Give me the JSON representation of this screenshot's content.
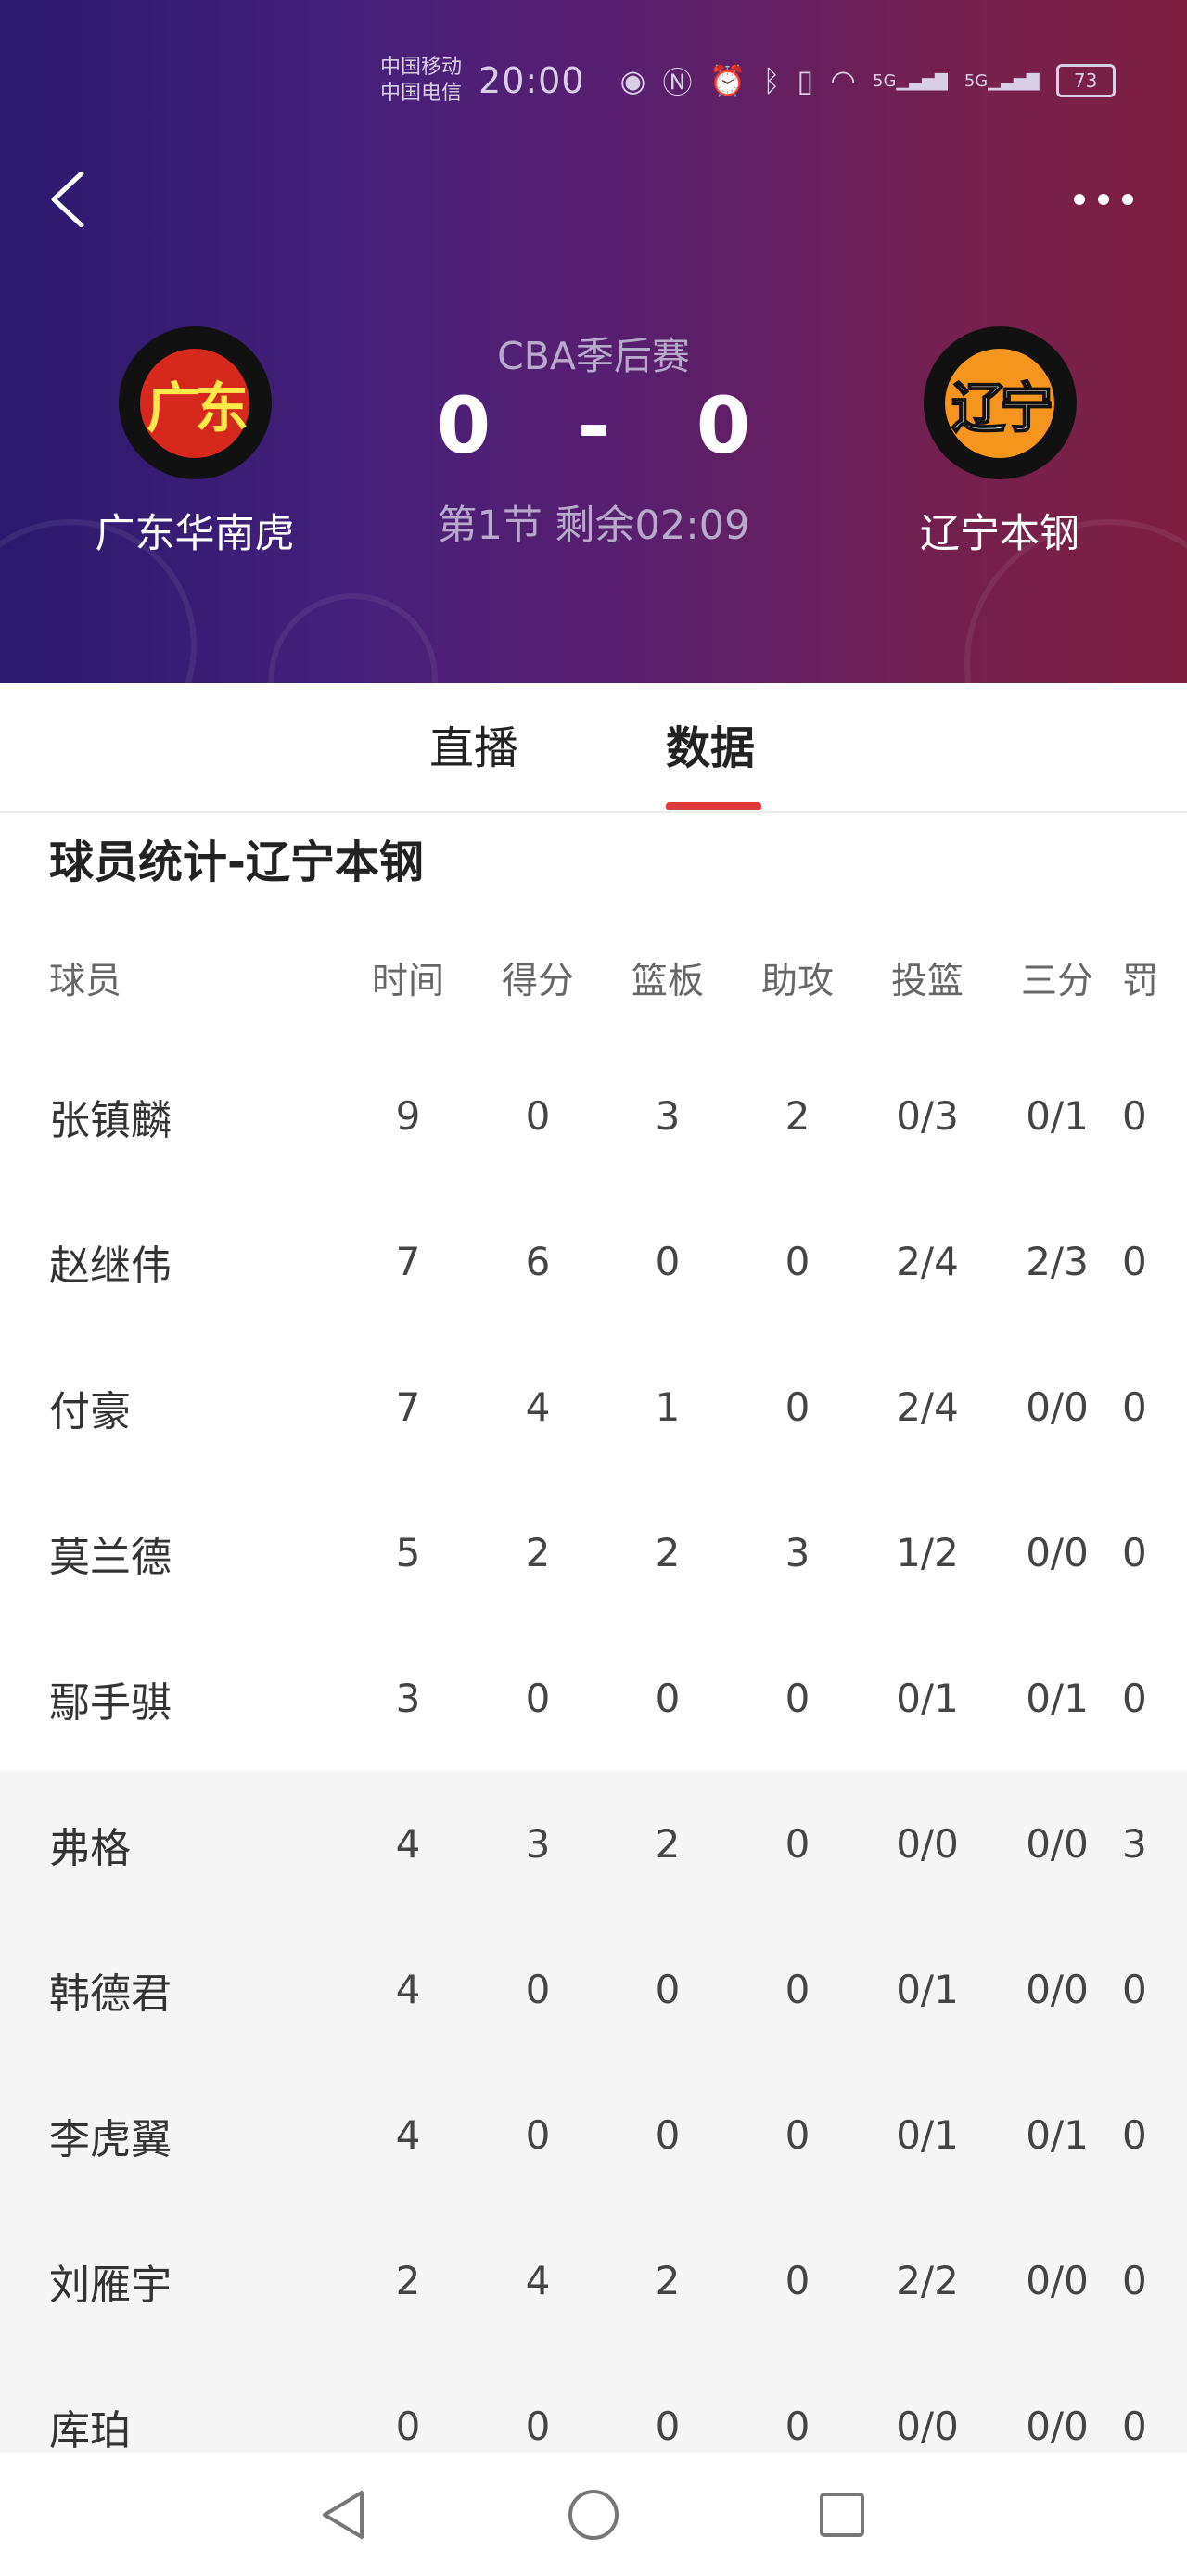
{
  "status": {
    "carrier1": "中国移动",
    "carrier2": "中国电信",
    "time": "20:00",
    "signal1": "5G",
    "signal2": "5G",
    "battery": "73"
  },
  "header": {
    "league": "CBA季后赛",
    "home_team": "广东华南虎",
    "home_logo_text": "广东",
    "away_team": "辽宁本钢",
    "away_logo_text": "辽宁",
    "home_score": "0",
    "separator": "-",
    "away_score": "0",
    "period": "第1节 剩余02:09"
  },
  "tabs": [
    {
      "label": "直播",
      "active": false
    },
    {
      "label": "数据",
      "active": true
    }
  ],
  "stats": {
    "title": "球员统计-辽宁本钢",
    "columns": [
      "球员",
      "时间",
      "得分",
      "篮板",
      "助攻",
      "投篮",
      "三分",
      "罚"
    ],
    "rows": [
      {
        "name": "张镇麟",
        "cells": [
          "9",
          "0",
          "3",
          "2",
          "0/3",
          "0/1",
          "0"
        ]
      },
      {
        "name": "赵继伟",
        "cells": [
          "7",
          "6",
          "0",
          "0",
          "2/4",
          "2/3",
          "0"
        ]
      },
      {
        "name": "付豪",
        "cells": [
          "7",
          "4",
          "1",
          "0",
          "2/4",
          "0/0",
          "0"
        ]
      },
      {
        "name": "莫兰德",
        "cells": [
          "5",
          "2",
          "2",
          "3",
          "1/2",
          "0/0",
          "0"
        ]
      },
      {
        "name": "鄢手骐",
        "cells": [
          "3",
          "0",
          "0",
          "0",
          "0/1",
          "0/1",
          "0"
        ]
      },
      {
        "name": "弗格",
        "cells": [
          "4",
          "3",
          "2",
          "0",
          "0/0",
          "0/0",
          "3"
        ]
      },
      {
        "name": "韩德君",
        "cells": [
          "4",
          "0",
          "0",
          "0",
          "0/1",
          "0/0",
          "0"
        ]
      },
      {
        "name": "李虎翼",
        "cells": [
          "4",
          "0",
          "0",
          "0",
          "0/1",
          "0/1",
          "0"
        ]
      },
      {
        "name": "刘雁宇",
        "cells": [
          "2",
          "4",
          "2",
          "0",
          "2/2",
          "0/0",
          "0"
        ]
      },
      {
        "name": "库珀",
        "cells": [
          "0",
          "0",
          "0",
          "0",
          "0/0",
          "0/0",
          "0"
        ]
      }
    ]
  },
  "colors": {
    "accent": "#e0393d",
    "header_start": "#2a1a6e",
    "header_end": "#7e1f40"
  }
}
